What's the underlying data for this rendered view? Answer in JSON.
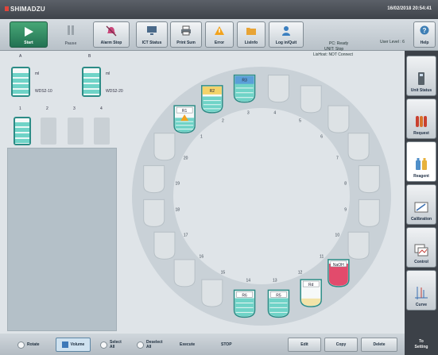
{
  "app": {
    "brand": "SHIMADZU",
    "datetime": "16/02/2018 20:54:41"
  },
  "toolbar": {
    "buttons": [
      {
        "key": "start",
        "label": "Start"
      },
      {
        "key": "pause",
        "label": "Pause"
      },
      {
        "key": "alarm",
        "label": "Alarm Stop"
      },
      {
        "key": "icstatus",
        "label": "ICT Status"
      },
      {
        "key": "printsum",
        "label": "Print Sum"
      },
      {
        "key": "error",
        "label": "Error"
      },
      {
        "key": "lisinfo",
        "label": "LisInfo"
      },
      {
        "key": "login",
        "label": "Log in/Quit"
      }
    ],
    "status": {
      "pc": "PC: Ready",
      "unit": "UNIT: Stop",
      "lis": "LisHost: NOT Connect"
    },
    "user_level": "User Level : 6",
    "help": "Help"
  },
  "left": {
    "top_bottles": [
      {
        "id": "A",
        "ml": "ml",
        "name": "WDS2-10"
      },
      {
        "id": "B",
        "ml": "ml",
        "name": "WDS2-20"
      }
    ],
    "small_slots": [
      "1",
      "2",
      "3",
      "4"
    ]
  },
  "carousel": {
    "positions": [
      {
        "n": "1",
        "label": "R1",
        "fill": 0.55,
        "color": "teal",
        "warn": true
      },
      {
        "n": "2",
        "label": "R2",
        "fill": 0.6,
        "color": "yellow"
      },
      {
        "n": "3",
        "label": "R3",
        "fill": 0.7,
        "color": "blue"
      },
      {
        "n": "4",
        "label": "",
        "fill": 0
      },
      {
        "n": "5",
        "label": "",
        "fill": 0
      },
      {
        "n": "6",
        "label": "",
        "fill": 0
      },
      {
        "n": "7",
        "label": "",
        "fill": 0
      },
      {
        "n": "8",
        "label": "",
        "fill": 0
      },
      {
        "n": "9",
        "label": "",
        "fill": 0
      },
      {
        "n": "10",
        "label": "",
        "fill": 0
      },
      {
        "n": "11",
        "label": "NaOH",
        "fill": 0.85,
        "color": "red"
      },
      {
        "n": "12",
        "label": "Rd",
        "fill": 0.3,
        "color": "cream"
      },
      {
        "n": "13",
        "label": "R5",
        "fill": 0.7,
        "color": "teal"
      },
      {
        "n": "14",
        "label": "R6",
        "fill": 0.7,
        "color": "teal"
      },
      {
        "n": "15",
        "label": "",
        "fill": 0
      },
      {
        "n": "16",
        "label": "",
        "fill": 0
      },
      {
        "n": "17",
        "label": "",
        "fill": 0
      },
      {
        "n": "18",
        "label": "",
        "fill": 0
      },
      {
        "n": "19",
        "label": "",
        "fill": 0
      },
      {
        "n": "20",
        "label": "",
        "fill": 0
      }
    ]
  },
  "sidebar": [
    {
      "key": "unit",
      "label": "Unit Status"
    },
    {
      "key": "request",
      "label": "Request"
    },
    {
      "key": "reagent",
      "label": "Reagent"
    },
    {
      "key": "calibration",
      "label": "Calibration"
    },
    {
      "key": "control",
      "label": "Control"
    },
    {
      "key": "curve",
      "label": "Curve"
    },
    {
      "key": "setting",
      "label": "To Setting"
    }
  ],
  "bottom": {
    "rotate": "Rotate",
    "volume": "Volume",
    "selectall": "Select All",
    "deselectall": "Deselect All",
    "execute": "Execute",
    "stop": "STOP",
    "edit": "Edit",
    "copy": "Copy",
    "delete": "Delete"
  },
  "colors": {
    "teal": "#2c8c86",
    "liquid": "#6fd3c7",
    "red": "#e24b6c",
    "yellow": "#f3d36a",
    "blue": "#5a9fd8",
    "cream": "#f2e3a8"
  }
}
